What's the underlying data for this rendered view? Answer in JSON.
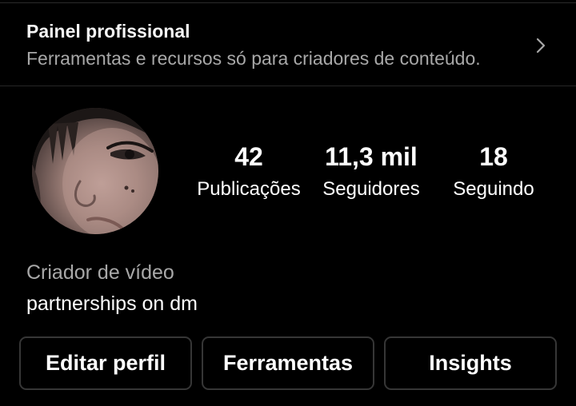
{
  "professional_panel": {
    "title": "Painel profissional",
    "subtitle": "Ferramentas e recursos só para criadores de conteúdo.",
    "chevron_icon": "chevron-right-icon"
  },
  "profile": {
    "avatar": "profile-photo",
    "stats": {
      "posts": {
        "value": "42",
        "label": "Publicações"
      },
      "followers": {
        "value": "11,3 mil",
        "label": "Seguidores"
      },
      "following": {
        "value": "18",
        "label": "Seguindo"
      }
    },
    "category": "Criador de vídeo",
    "bio": "partnerships on dm"
  },
  "actions": {
    "edit_profile": "Editar perfil",
    "tools": "Ferramentas",
    "insights": "Insights"
  },
  "colors": {
    "background": "#000000",
    "primary_text": "#ffffff",
    "secondary_text": "#a8a8a8",
    "button_border": "#363636",
    "divider": "#262626"
  }
}
